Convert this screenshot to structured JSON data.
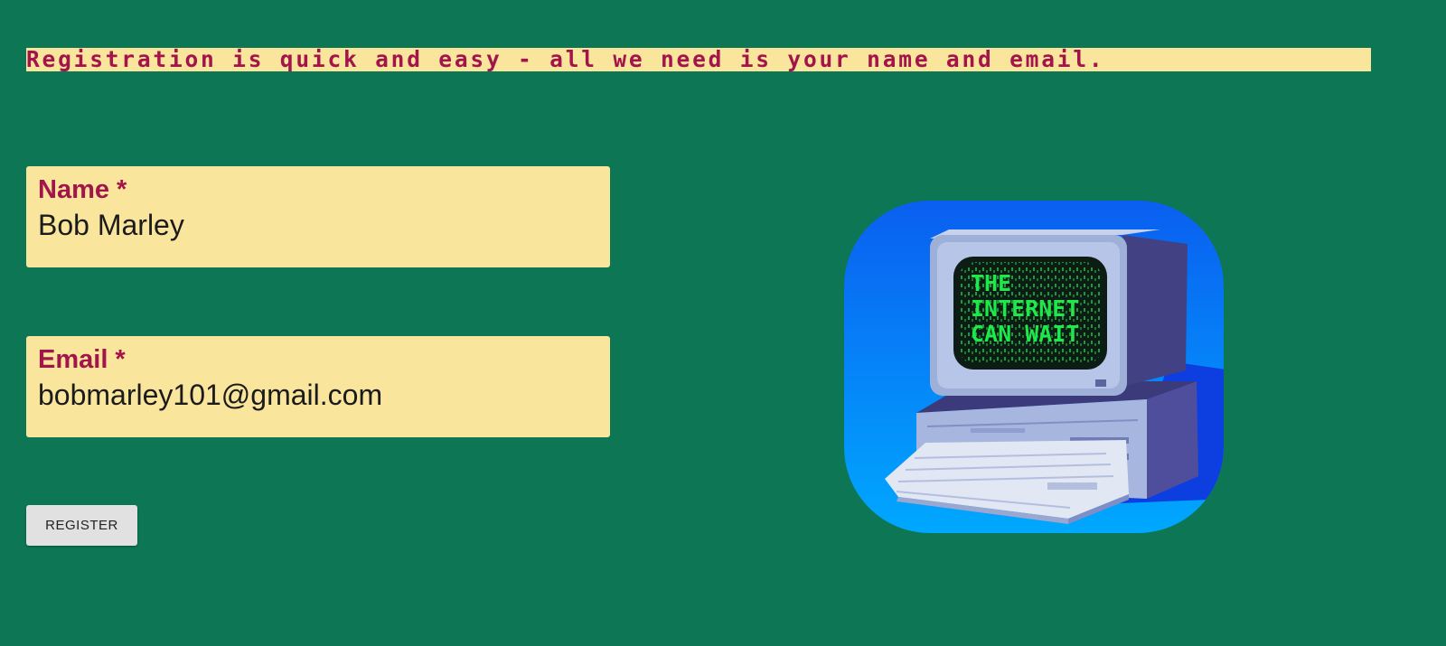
{
  "intro": {
    "text": "Registration is quick and easy - all we need is your name and email."
  },
  "form": {
    "name_field": {
      "label": "Name *",
      "value": "Bob Marley"
    },
    "email_field": {
      "label": "Email *",
      "value": "bobmarley101@gmail.com"
    },
    "register_label": "REGISTER"
  },
  "illustration": {
    "icon": "retro-computer-icon",
    "screen_lines": [
      "THE",
      "INTERNET",
      "CAN WAIT"
    ],
    "colors": {
      "background_top": "#0a5ff0",
      "background_bottom": "#00a8ff",
      "screen_text": "#1ee84a"
    }
  },
  "colors": {
    "page_background": "#0d7755",
    "field_background": "#f9e59c",
    "accent": "#a3154a",
    "button_background": "#e1e1e1"
  }
}
